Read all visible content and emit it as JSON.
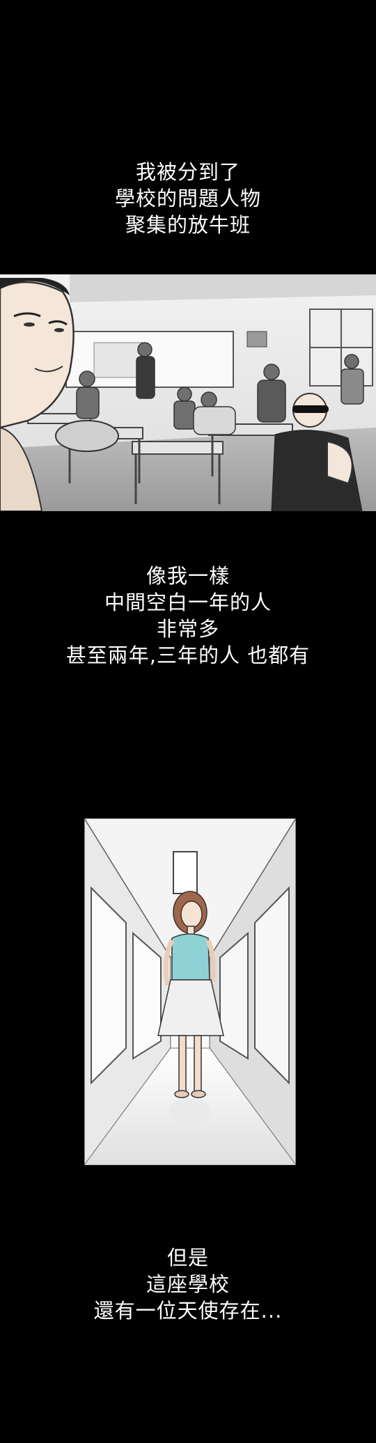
{
  "captions": [
    {
      "lines": [
        "我被分到了",
        "學校的問題人物",
        "聚集的放牛班"
      ]
    },
    {
      "lines": [
        "像我一樣",
        "中間空白一年的人",
        "非常多",
        "甚至兩年,三年的人 也都有"
      ]
    },
    {
      "lines": [
        "但是",
        "這座學校",
        "還有一位天使存在..."
      ]
    }
  ]
}
